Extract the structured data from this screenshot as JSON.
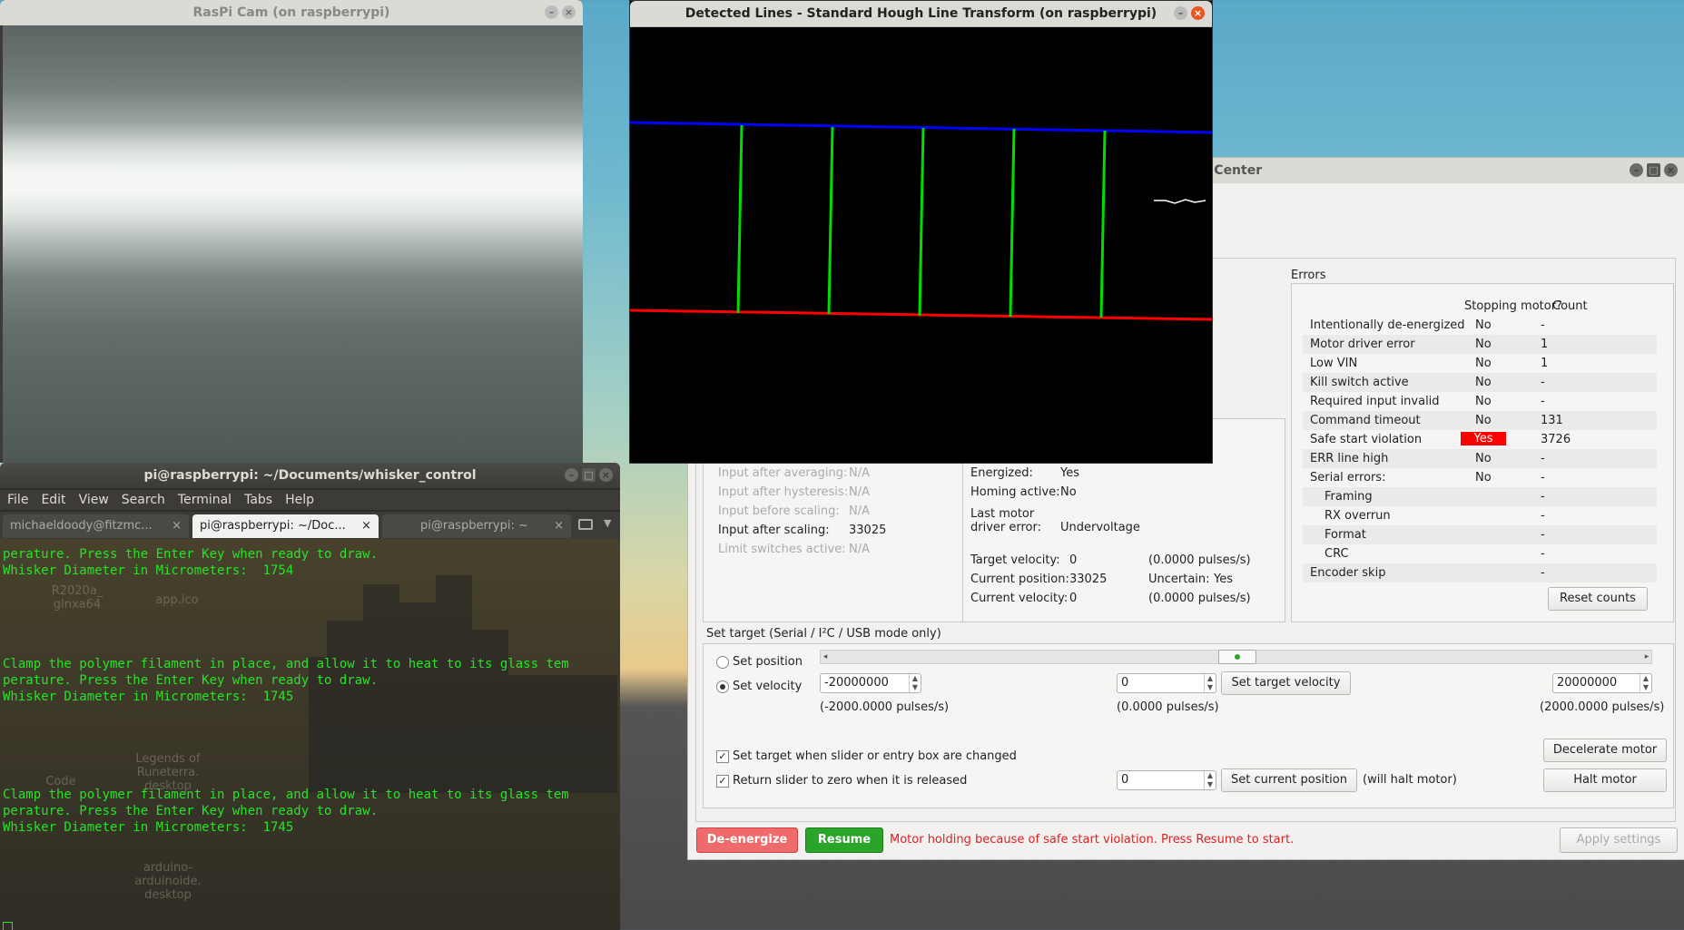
{
  "cam_window": {
    "title": "RasPi Cam (on raspberrypi)"
  },
  "hough_window": {
    "title": "Detected Lines - Standard Hough Line Transform (on raspberrypi)"
  },
  "terminal": {
    "title": "pi@raspberrypi: ~/Documents/whisker_control",
    "menu": [
      "File",
      "Edit",
      "View",
      "Search",
      "Terminal",
      "Tabs",
      "Help"
    ],
    "tabs": [
      {
        "label": "michaeldoody@fitzmc...",
        "close": "×"
      },
      {
        "label": "pi@raspberrypi: ~/Doc...",
        "close": "×"
      },
      {
        "label": "pi@raspberrypi: ~",
        "close": "×"
      }
    ],
    "lines": [
      "perature. Press the Enter Key when ready to draw.",
      "Whisker Diameter in Micrometers:  1754",
      "Clamp the polymer filament in place, and allow it to heat to its glass tem",
      "perature. Press the Enter Key when ready to draw.",
      "Whisker Diameter in Micrometers:  1745",
      "Clamp the polymer filament in place, and allow it to heat to its glass tem",
      "perature. Press the Enter Key when ready to draw.",
      "Whisker Diameter in Micrometers:  1745"
    ],
    "desktop_icons": [
      "R2020a_ glnxa64",
      "app.ico",
      "Legends of Runeterra. desktop",
      "Code",
      "arduino- arduinoide. desktop"
    ]
  },
  "tic": {
    "title": "ol Center",
    "inputs": {
      "input_after_averaging": {
        "label": "Input after averaging:",
        "value": "N/A"
      },
      "input_after_hysteresis": {
        "label": "Input after hysteresis:",
        "value": "N/A"
      },
      "input_before_scaling": {
        "label": "Input before scaling:",
        "value": "N/A"
      },
      "input_after_scaling": {
        "label": "Input after scaling:",
        "value": "33025"
      },
      "limit_switches": {
        "label": "Limit switches active:",
        "value": "N/A"
      }
    },
    "status": {
      "energized": {
        "label": "Energized:",
        "value": "Yes"
      },
      "homing": {
        "label": "Homing active:",
        "value": "No"
      },
      "last_error_label1": "Last motor",
      "last_error_label2": "driver error:",
      "last_error_value": "Undervoltage",
      "target_velocity": {
        "label": "Target velocity:",
        "value": "0",
        "pulses": "(0.0000 pulses/s)"
      },
      "current_position": {
        "label": "Current position:",
        "value": "33025",
        "uncertain_label": "Uncertain:",
        "uncertain_value": "Yes"
      },
      "current_velocity": {
        "label": "Current velocity:",
        "value": "0",
        "pulses": "(0.0000 pulses/s)"
      }
    },
    "errors": {
      "title": "Errors",
      "col_stopping": "Stopping motor?",
      "col_count": "Count",
      "rows": [
        {
          "name": "Intentionally de-energized",
          "stopping": "No",
          "count": "-"
        },
        {
          "name": "Motor driver error",
          "stopping": "No",
          "count": "1"
        },
        {
          "name": "Low VIN",
          "stopping": "No",
          "count": "1"
        },
        {
          "name": "Kill switch active",
          "stopping": "No",
          "count": "-"
        },
        {
          "name": "Required input invalid",
          "stopping": "No",
          "count": "-"
        },
        {
          "name": "Command timeout",
          "stopping": "No",
          "count": "131"
        },
        {
          "name": "Safe start violation",
          "stopping": "Yes",
          "count": "3726"
        },
        {
          "name": "ERR line high",
          "stopping": "No",
          "count": "-"
        },
        {
          "name": "Serial errors:",
          "stopping": "No",
          "count": "-"
        },
        {
          "name": "Framing",
          "stopping": "",
          "count": "-"
        },
        {
          "name": "RX overrun",
          "stopping": "",
          "count": "-"
        },
        {
          "name": "Format",
          "stopping": "",
          "count": "-"
        },
        {
          "name": "CRC",
          "stopping": "",
          "count": "-"
        },
        {
          "name": "Encoder skip",
          "stopping": "",
          "count": "-"
        }
      ],
      "reset_button": "Reset counts"
    },
    "set_target": {
      "title": "Set target (Serial / I²C / USB mode only)",
      "set_position": "Set position",
      "set_velocity": "Set velocity",
      "min_value": "-20000000",
      "mid_value": "0",
      "max_value": "20000000",
      "min_pulses": "(-2000.0000 pulses/s)",
      "mid_pulses": "(0.0000 pulses/s)",
      "max_pulses": "(2000.0000 pulses/s)",
      "set_target_velocity_button": "Set target velocity",
      "chk_set_target": "Set target when slider or entry box are changed",
      "chk_return_zero": "Return slider to zero when it is released",
      "position_value": "0",
      "set_current_position_button": "Set current position",
      "will_halt": "(will halt motor)",
      "decelerate_button": "Decelerate motor",
      "halt_button": "Halt motor",
      "slider_level": 0.5
    },
    "bottom": {
      "deenergize": "De-energize",
      "resume": "Resume",
      "message": "Motor holding because of safe start violation.  Press Resume to start.",
      "apply": "Apply settings"
    }
  },
  "colors": {
    "accent_red": "#e95420",
    "terminal_green": "#27e327",
    "hough_top": "#0000ff",
    "hough_bottom": "#ff0000",
    "hough_vertical": "#00dd00",
    "yes_badge": "#ff0000"
  }
}
